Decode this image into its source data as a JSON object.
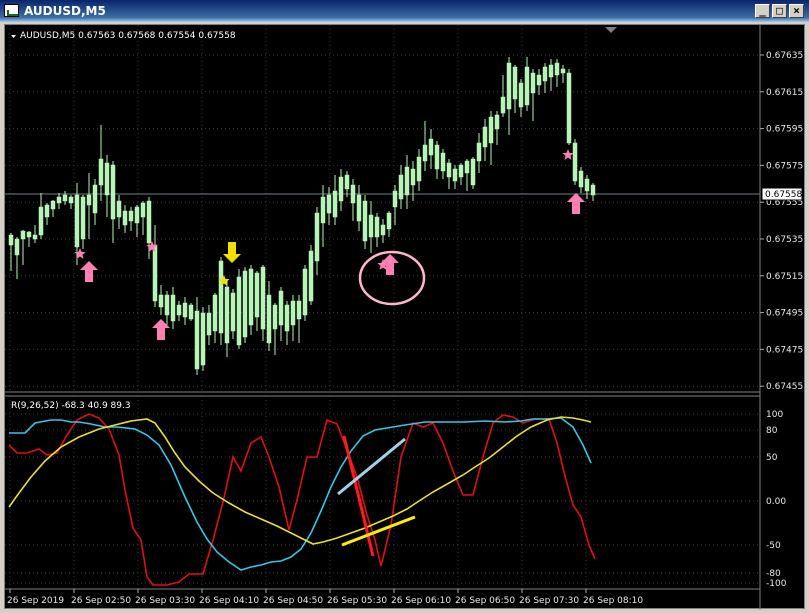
{
  "window": {
    "title": "AUDUSD,M5",
    "minimize_glyph": "_",
    "restore_glyph": "□",
    "close_glyph": "×"
  },
  "chart": {
    "info_label": "AUDUSD,M5  0.67563 0.67568 0.67554 0.67558",
    "current_price": "0.67558",
    "price_ticks": [
      "0.67635",
      "0.67615",
      "0.67595",
      "0.67575",
      "0.67555",
      "0.67535",
      "0.67515",
      "0.67495",
      "0.67475",
      "0.67455"
    ],
    "time_ticks": [
      "26 Sep 2019",
      "26 Sep 02:50",
      "26 Sep 03:30",
      "26 Sep 04:10",
      "26 Sep 04:50",
      "26 Sep 05:30",
      "26 Sep 06:10",
      "26 Sep 06:50",
      "26 Sep 07:30",
      "26 Sep 08:10"
    ],
    "colors": {
      "background": "#000000",
      "candle": "#b6f5b6",
      "grid": "#3a3a3a",
      "price_line": "#6b7f8a"
    }
  },
  "indicator": {
    "label": "R(9,26,52) -68.3 40.9 89.3",
    "ticks": [
      "100",
      "80",
      "50",
      "0.00",
      "-50",
      "-80",
      "-100"
    ],
    "series_colors": {
      "red": "#e01010",
      "cyan": "#35c6e8",
      "yellow": "#e8e030"
    }
  },
  "markers": {
    "colors": {
      "arrow_up": "#ff7fb4",
      "arrow_down": "#f2e000",
      "star_pink": "#ff7fb4",
      "star_yellow": "#f2e000"
    }
  },
  "annotations": {
    "colors": {
      "red_line": "#ff1a1a",
      "blue_line": "#9fd3ea",
      "yellow_line": "#ffee00",
      "circle": "#ffb6c8"
    }
  }
}
